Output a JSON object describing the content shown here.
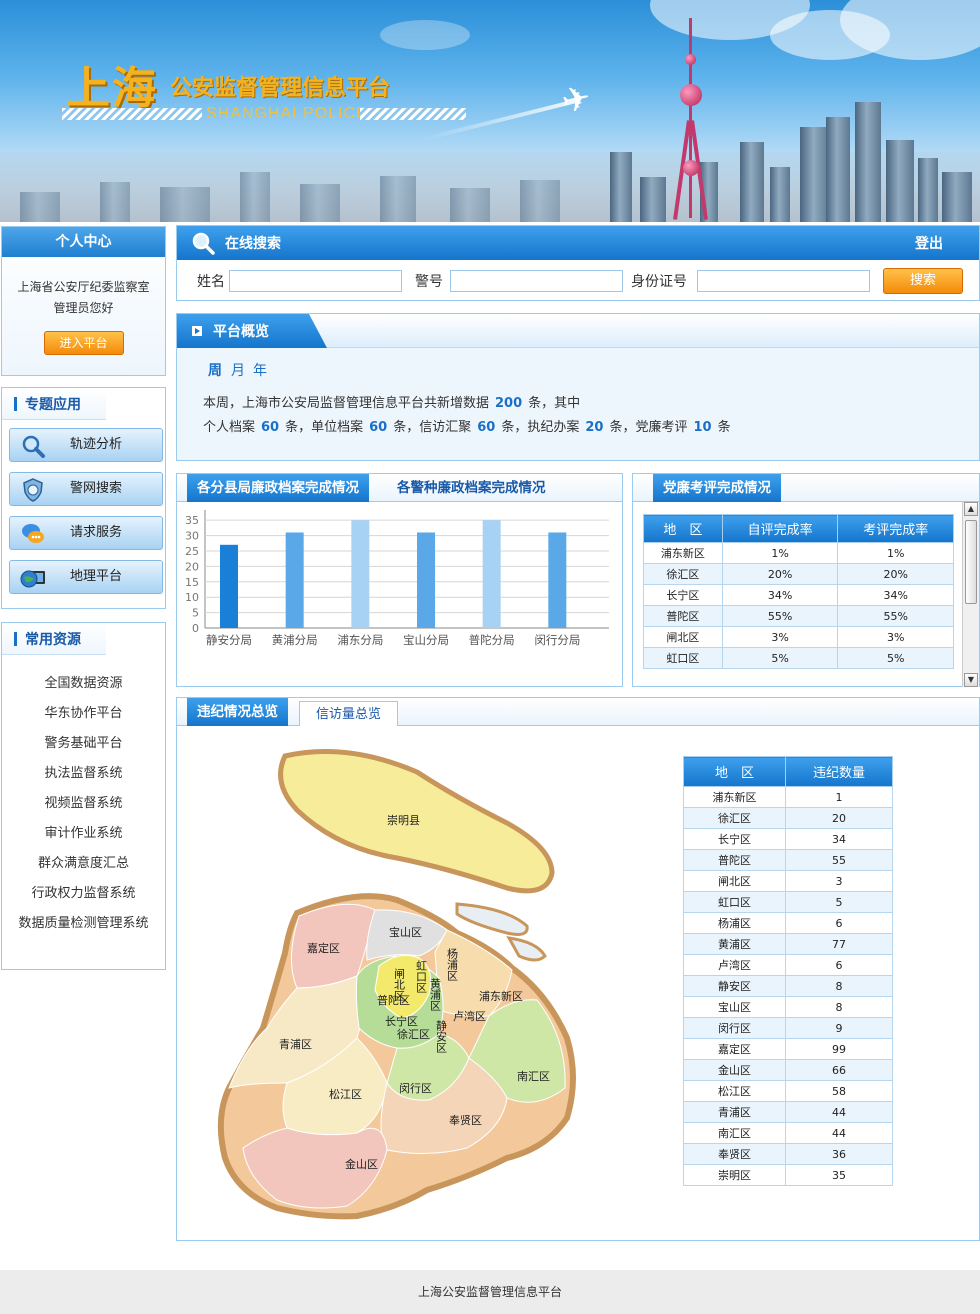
{
  "header": {
    "title_cn_big": "上海",
    "title_cn": "公安监督管理信息平台",
    "title_en": "SHANGHAI POLICE"
  },
  "user_center": {
    "title": "个人中心",
    "greeting_line1": "上海省公安厅纪委监察室",
    "greeting_line2": "管理员您好",
    "enter_button": "进入平台"
  },
  "special_apps": {
    "title": "专题应用",
    "items": [
      {
        "label": "轨迹分析",
        "icon": "magnifier-icon"
      },
      {
        "label": "警网搜索",
        "icon": "shield-globe-icon"
      },
      {
        "label": "请求服务",
        "icon": "chat-bubbles-icon"
      },
      {
        "label": "地理平台",
        "icon": "globe-monitor-icon"
      }
    ]
  },
  "resources": {
    "title": "常用资源",
    "items": [
      "全国数据资源",
      "华东协作平台",
      "警务基础平台",
      "执法监督系统",
      "视频监督系统",
      "审计作业系统",
      "群众满意度汇总",
      "行政权力监督系统",
      "数据质量检测管理系统"
    ]
  },
  "search": {
    "title": "在线搜索",
    "logout": "登出",
    "name_label": "姓名",
    "badge_label": "警号",
    "id_label": "身份证号",
    "name_value": "",
    "badge_value": "",
    "id_value": "",
    "button": "搜索"
  },
  "overview": {
    "title": "平台概览",
    "periods": [
      "周",
      "月",
      "年"
    ],
    "active_period": "周",
    "line1_prefix": "本周，上海市公安局监督管理信息平台共新增数据",
    "line1_num": "200",
    "line1_suffix": "条，其中",
    "items": [
      {
        "label": "个人档案",
        "num": "60",
        "unit": "条，"
      },
      {
        "label": "单位档案",
        "num": "60",
        "unit": "条，"
      },
      {
        "label": "信访汇聚",
        "num": "60",
        "unit": "条，"
      },
      {
        "label": "执纪办案",
        "num": "20",
        "unit": "条，"
      },
      {
        "label": "党廉考评",
        "num": "10",
        "unit": "条"
      }
    ]
  },
  "bar_panel": {
    "tab_active": "各分县局廉政档案完成情况",
    "tab_inactive": "各警种廉政档案完成情况"
  },
  "chart_data": {
    "type": "bar",
    "categories": [
      "静安分局",
      "黄浦分局",
      "浦东分局",
      "宝山分局",
      "普陀分局",
      "闵行分局"
    ],
    "values": [
      27,
      31,
      35,
      31,
      35,
      31
    ],
    "yticks": [
      0,
      5,
      10,
      15,
      20,
      25,
      30,
      35
    ],
    "ylim": [
      0,
      37
    ],
    "grid": true,
    "colors": [
      "#1a7fd6",
      "#5aa8e8",
      "#a8d2f3",
      "#5aa8e8",
      "#a8d2f3",
      "#5aa8e8"
    ]
  },
  "eval_panel": {
    "title": "党廉考评完成情况",
    "headers": [
      "地　区",
      "自评完成率",
      "考评完成率"
    ],
    "rows": [
      [
        "浦东新区",
        "1%",
        "1%"
      ],
      [
        "徐汇区",
        "20%",
        "20%"
      ],
      [
        "长宁区",
        "34%",
        "34%"
      ],
      [
        "普陀区",
        "55%",
        "55%"
      ],
      [
        "闸北区",
        "3%",
        "3%"
      ],
      [
        "虹口区",
        "5%",
        "5%"
      ]
    ]
  },
  "violations": {
    "tab_active": "违纪情况总览",
    "tab_inactive": "信访量总览",
    "headers": [
      "地　区",
      "违纪数量"
    ],
    "rows": [
      [
        "浦东新区",
        "1"
      ],
      [
        "徐汇区",
        "20"
      ],
      [
        "长宁区",
        "34"
      ],
      [
        "普陀区",
        "55"
      ],
      [
        "闸北区",
        "3"
      ],
      [
        "虹口区",
        "5"
      ],
      [
        "杨浦区",
        "6"
      ],
      [
        "黄浦区",
        "77"
      ],
      [
        "卢湾区",
        "6"
      ],
      [
        "静安区",
        "8"
      ],
      [
        "宝山区",
        "8"
      ],
      [
        "闵行区",
        "9"
      ],
      [
        "嘉定区",
        "99"
      ],
      [
        "金山区",
        "66"
      ],
      [
        "松江区",
        "58"
      ],
      [
        "青浦区",
        "44"
      ],
      [
        "南汇区",
        "44"
      ],
      [
        "奉贤区",
        "36"
      ],
      [
        "崇明区",
        "35"
      ]
    ],
    "map_labels": {
      "chongming": "崇明县",
      "baoshan": "宝山区",
      "jiading": "嘉定区",
      "yangpu": "杨浦区",
      "zhabei": "闸北区",
      "hongkou": "虹口区",
      "huangpu": "黄浦区",
      "putuo": "普陀区",
      "pudong": "浦东新区",
      "luwan": "卢湾区",
      "changning": "长宁区",
      "xuhui": "徐汇区",
      "jingan": "静安区",
      "qingpu": "青浦区",
      "nanhui": "南汇区",
      "songjiang": "松江区",
      "minhang": "闵行区",
      "fengxian": "奉贤区",
      "jinshan": "金山区"
    }
  },
  "footer": "上海公安监督管理信息平台"
}
